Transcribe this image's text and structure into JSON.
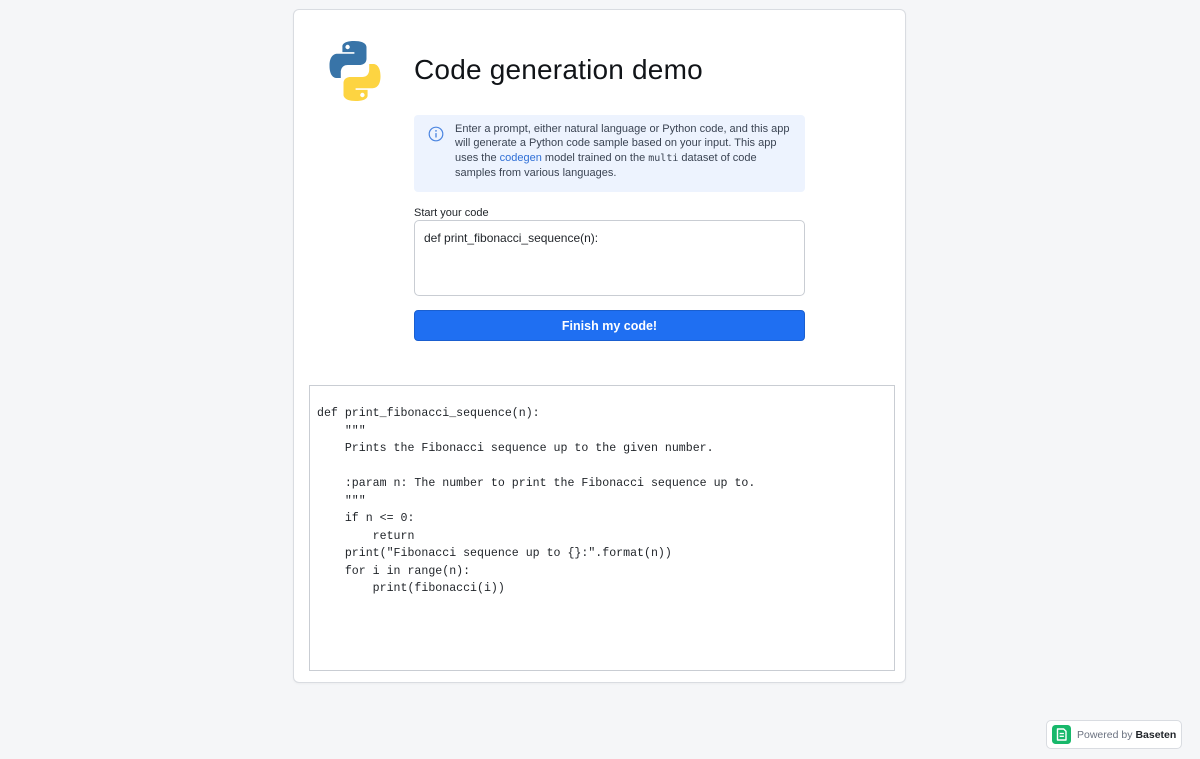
{
  "app": {
    "title": "Code generation demo"
  },
  "info_box": {
    "text_before_link": "Enter a prompt, either natural language or Python code, and this app will generate a Python code sample based on your input. This app uses the ",
    "link_text": "codegen",
    "text_after_link": " model trained on the ",
    "dataset_code": "multi",
    "text_end": " dataset of code samples from various languages."
  },
  "input": {
    "label": "Start your code",
    "value": "def print_fibonacci_sequence(n):"
  },
  "submit_button": {
    "label": "Finish my code!"
  },
  "output": {
    "code": "def print_fibonacci_sequence(n):\n    \"\"\"\n    Prints the Fibonacci sequence up to the given number.\n\n    :param n: The number to print the Fibonacci sequence up to.\n    \"\"\"\n    if n <= 0:\n        return\n    print(\"Fibonacci sequence up to {}:\".format(n))\n    for i in range(n):\n        print(fibonacci(i))"
  },
  "footer": {
    "powered_prefix": "Powered by",
    "brand": "Baseten"
  },
  "icons": {
    "logo": "python-logo-icon",
    "info": "info-circle-icon",
    "brand": "baseten-logo-icon"
  },
  "colors": {
    "accent": "#1f6ff2",
    "info_bg": "#edf3fe",
    "python_blue": "#3874a8",
    "python_yellow": "#fdd441",
    "brand_green": "#17b86b"
  }
}
